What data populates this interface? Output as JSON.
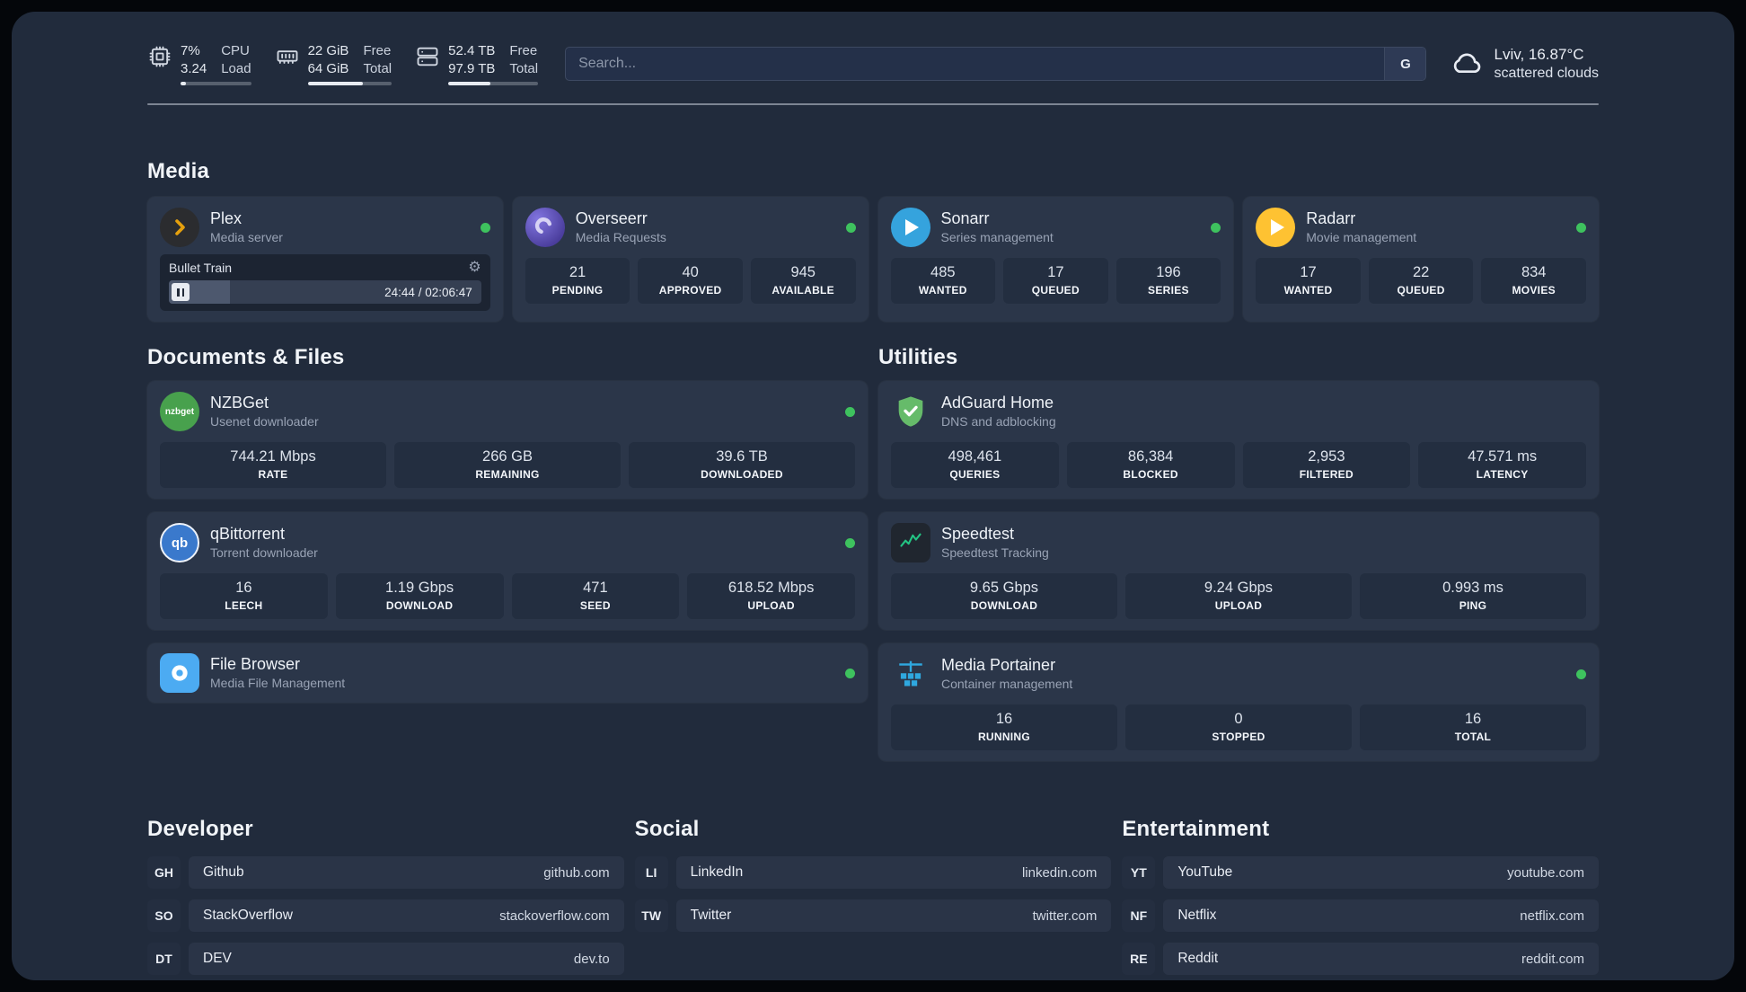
{
  "topbar": {
    "cpu": {
      "value_top": "7%",
      "value_bottom": "3.24",
      "label_top": "CPU",
      "label_bottom": "Load",
      "progress_pct": 7
    },
    "ram": {
      "value_top": "22 GiB",
      "value_bottom": "64 GiB",
      "label_top": "Free",
      "label_bottom": "Total",
      "progress_pct": 66
    },
    "disk": {
      "value_top": "52.4 TB",
      "value_bottom": "97.9 TB",
      "label_top": "Free",
      "label_bottom": "Total",
      "progress_pct": 47
    },
    "search": {
      "placeholder": "Search...",
      "button_label": "G"
    },
    "weather": {
      "location": "Lviv, 16.87°C",
      "condition": "scattered clouds"
    }
  },
  "media": {
    "heading": "Media",
    "plex": {
      "name": "Plex",
      "subtitle": "Media server",
      "player": {
        "title": "Bullet Train",
        "time": "24:44 / 02:06:47",
        "progress_pct": 19.5
      }
    },
    "overseerr": {
      "name": "Overseerr",
      "subtitle": "Media Requests",
      "stats": [
        {
          "value": "21",
          "label": "PENDING"
        },
        {
          "value": "40",
          "label": "APPROVED"
        },
        {
          "value": "945",
          "label": "AVAILABLE"
        }
      ]
    },
    "sonarr": {
      "name": "Sonarr",
      "subtitle": "Series management",
      "stats": [
        {
          "value": "485",
          "label": "WANTED"
        },
        {
          "value": "17",
          "label": "QUEUED"
        },
        {
          "value": "196",
          "label": "SERIES"
        }
      ]
    },
    "radarr": {
      "name": "Radarr",
      "subtitle": "Movie management",
      "stats": [
        {
          "value": "17",
          "label": "WANTED"
        },
        {
          "value": "22",
          "label": "QUEUED"
        },
        {
          "value": "834",
          "label": "MOVIES"
        }
      ]
    }
  },
  "documents": {
    "heading": "Documents & Files",
    "nzbget": {
      "name": "NZBGet",
      "subtitle": "Usenet downloader",
      "stats": [
        {
          "value": "744.21 Mbps",
          "label": "RATE"
        },
        {
          "value": "266 GB",
          "label": "REMAINING"
        },
        {
          "value": "39.6 TB",
          "label": "DOWNLOADED"
        }
      ]
    },
    "qbittorrent": {
      "name": "qBittorrent",
      "subtitle": "Torrent downloader",
      "stats": [
        {
          "value": "16",
          "label": "LEECH"
        },
        {
          "value": "1.19 Gbps",
          "label": "DOWNLOAD"
        },
        {
          "value": "471",
          "label": "SEED"
        },
        {
          "value": "618.52 Mbps",
          "label": "UPLOAD"
        }
      ]
    },
    "filebrowser": {
      "name": "File Browser",
      "subtitle": "Media File Management"
    }
  },
  "utilities": {
    "heading": "Utilities",
    "adguard": {
      "name": "AdGuard Home",
      "subtitle": "DNS and adblocking",
      "stats": [
        {
          "value": "498,461",
          "label": "QUERIES"
        },
        {
          "value": "86,384",
          "label": "BLOCKED"
        },
        {
          "value": "2,953",
          "label": "FILTERED"
        },
        {
          "value": "47.571 ms",
          "label": "LATENCY"
        }
      ]
    },
    "speedtest": {
      "name": "Speedtest",
      "subtitle": "Speedtest Tracking",
      "stats": [
        {
          "value": "9.65 Gbps",
          "label": "DOWNLOAD"
        },
        {
          "value": "9.24 Gbps",
          "label": "UPLOAD"
        },
        {
          "value": "0.993 ms",
          "label": "PING"
        }
      ]
    },
    "portainer": {
      "name": "Media Portainer",
      "subtitle": "Container management",
      "stats": [
        {
          "value": "16",
          "label": "RUNNING"
        },
        {
          "value": "0",
          "label": "STOPPED"
        },
        {
          "value": "16",
          "label": "TOTAL"
        }
      ]
    }
  },
  "bookmarks": {
    "developer": {
      "heading": "Developer",
      "items": [
        {
          "abbr": "GH",
          "name": "Github",
          "url": "github.com"
        },
        {
          "abbr": "SO",
          "name": "StackOverflow",
          "url": "stackoverflow.com"
        },
        {
          "abbr": "DT",
          "name": "DEV",
          "url": "dev.to"
        }
      ]
    },
    "social": {
      "heading": "Social",
      "items": [
        {
          "abbr": "LI",
          "name": "LinkedIn",
          "url": "linkedin.com"
        },
        {
          "abbr": "TW",
          "name": "Twitter",
          "url": "twitter.com"
        }
      ]
    },
    "entertainment": {
      "heading": "Entertainment",
      "items": [
        {
          "abbr": "YT",
          "name": "YouTube",
          "url": "youtube.com"
        },
        {
          "abbr": "NF",
          "name": "Netflix",
          "url": "netflix.com"
        },
        {
          "abbr": "RE",
          "name": "Reddit",
          "url": "reddit.com"
        }
      ]
    }
  },
  "icons": {
    "qbittorrent_glyph": "qb",
    "nzbget_glyph": "nzbget"
  },
  "colors": {
    "page_bg": "#212b3c",
    "card_bg": "#2b3649",
    "tile_bg": "#232e40",
    "status_online": "#3ec25e",
    "plex_gold": "#e5a00d",
    "sonarr_blue": "#35a3dd",
    "radarr_yellow": "#fec232",
    "nzbget_green": "#48a14d",
    "qbittorrent_blue": "#3a79cc",
    "filebrowser_blue": "#4cabf2",
    "adguard_green": "#66bb6a",
    "speedtest_green": "#23c483",
    "portainer_blue": "#2fa8e0",
    "overseerr_purple": "#4a3d9c"
  }
}
